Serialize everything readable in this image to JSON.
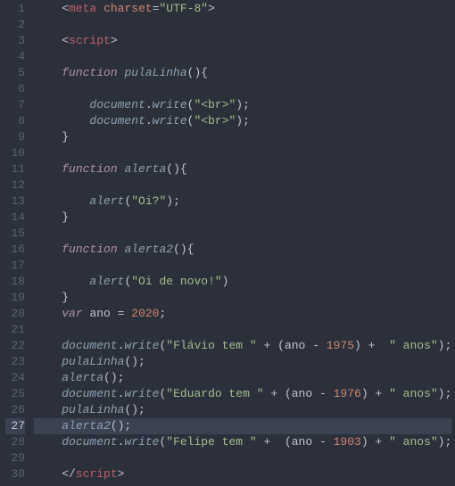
{
  "lines": [
    {
      "n": 1,
      "hl": false,
      "seg": [
        {
          "c": "txt",
          "t": "    "
        },
        {
          "c": "lt",
          "t": "<"
        },
        {
          "c": "tag",
          "t": "meta"
        },
        {
          "c": "txt",
          "t": " "
        },
        {
          "c": "attr",
          "t": "charset"
        },
        {
          "c": "pun",
          "t": "="
        },
        {
          "c": "str",
          "t": "\"UTF-8\""
        },
        {
          "c": "lt",
          "t": ">"
        }
      ]
    },
    {
      "n": 2,
      "hl": false,
      "seg": [
        {
          "c": "txt",
          "t": ""
        }
      ]
    },
    {
      "n": 3,
      "hl": false,
      "seg": [
        {
          "c": "txt",
          "t": "    "
        },
        {
          "c": "lt",
          "t": "<"
        },
        {
          "c": "tag",
          "t": "script"
        },
        {
          "c": "lt",
          "t": ">"
        }
      ]
    },
    {
      "n": 4,
      "hl": false,
      "seg": [
        {
          "c": "txt",
          "t": ""
        }
      ]
    },
    {
      "n": 5,
      "hl": false,
      "seg": [
        {
          "c": "txt",
          "t": "    "
        },
        {
          "c": "kw",
          "t": "function"
        },
        {
          "c": "txt",
          "t": " "
        },
        {
          "c": "fn",
          "t": "pulaLinha"
        },
        {
          "c": "pun",
          "t": "(){"
        }
      ]
    },
    {
      "n": 6,
      "hl": false,
      "seg": [
        {
          "c": "txt",
          "t": ""
        }
      ]
    },
    {
      "n": 7,
      "hl": false,
      "seg": [
        {
          "c": "txt",
          "t": "        "
        },
        {
          "c": "obj",
          "t": "document"
        },
        {
          "c": "pun",
          "t": "."
        },
        {
          "c": "fn",
          "t": "write"
        },
        {
          "c": "pun",
          "t": "("
        },
        {
          "c": "str",
          "t": "\"<br>\""
        },
        {
          "c": "pun",
          "t": ");"
        }
      ]
    },
    {
      "n": 8,
      "hl": false,
      "seg": [
        {
          "c": "txt",
          "t": "        "
        },
        {
          "c": "obj",
          "t": "document"
        },
        {
          "c": "pun",
          "t": "."
        },
        {
          "c": "fn",
          "t": "write"
        },
        {
          "c": "pun",
          "t": "("
        },
        {
          "c": "str",
          "t": "\"<br>\""
        },
        {
          "c": "pun",
          "t": ");"
        }
      ]
    },
    {
      "n": 9,
      "hl": false,
      "seg": [
        {
          "c": "txt",
          "t": "    "
        },
        {
          "c": "pun",
          "t": "}"
        }
      ]
    },
    {
      "n": 10,
      "hl": false,
      "seg": [
        {
          "c": "txt",
          "t": ""
        }
      ]
    },
    {
      "n": 11,
      "hl": false,
      "seg": [
        {
          "c": "txt",
          "t": "    "
        },
        {
          "c": "kw",
          "t": "function"
        },
        {
          "c": "txt",
          "t": " "
        },
        {
          "c": "fn",
          "t": "alerta"
        },
        {
          "c": "pun",
          "t": "(){"
        }
      ]
    },
    {
      "n": 12,
      "hl": false,
      "seg": [
        {
          "c": "txt",
          "t": ""
        }
      ]
    },
    {
      "n": 13,
      "hl": false,
      "seg": [
        {
          "c": "txt",
          "t": "        "
        },
        {
          "c": "fn",
          "t": "alert"
        },
        {
          "c": "pun",
          "t": "("
        },
        {
          "c": "str",
          "t": "\"Oi?\""
        },
        {
          "c": "pun",
          "t": ");"
        }
      ]
    },
    {
      "n": 14,
      "hl": false,
      "seg": [
        {
          "c": "txt",
          "t": "    "
        },
        {
          "c": "pun",
          "t": "}"
        }
      ]
    },
    {
      "n": 15,
      "hl": false,
      "seg": [
        {
          "c": "txt",
          "t": ""
        }
      ]
    },
    {
      "n": 16,
      "hl": false,
      "seg": [
        {
          "c": "txt",
          "t": "    "
        },
        {
          "c": "kw",
          "t": "function"
        },
        {
          "c": "txt",
          "t": " "
        },
        {
          "c": "fn",
          "t": "alerta2"
        },
        {
          "c": "pun",
          "t": "(){"
        }
      ]
    },
    {
      "n": 17,
      "hl": false,
      "seg": [
        {
          "c": "txt",
          "t": ""
        }
      ]
    },
    {
      "n": 18,
      "hl": false,
      "seg": [
        {
          "c": "txt",
          "t": "        "
        },
        {
          "c": "fn",
          "t": "alert"
        },
        {
          "c": "pun",
          "t": "("
        },
        {
          "c": "str",
          "t": "\"Oi de novo!\""
        },
        {
          "c": "pun",
          "t": ")"
        }
      ]
    },
    {
      "n": 19,
      "hl": false,
      "seg": [
        {
          "c": "txt",
          "t": "    "
        },
        {
          "c": "pun",
          "t": "}"
        }
      ]
    },
    {
      "n": 20,
      "hl": false,
      "seg": [
        {
          "c": "txt",
          "t": "    "
        },
        {
          "c": "kw2",
          "t": "var"
        },
        {
          "c": "txt",
          "t": " "
        },
        {
          "c": "txt",
          "t": "ano "
        },
        {
          "c": "op",
          "t": "="
        },
        {
          "c": "txt",
          "t": " "
        },
        {
          "c": "num",
          "t": "2020"
        },
        {
          "c": "pun",
          "t": ";"
        }
      ]
    },
    {
      "n": 21,
      "hl": false,
      "seg": [
        {
          "c": "txt",
          "t": ""
        }
      ]
    },
    {
      "n": 22,
      "hl": false,
      "seg": [
        {
          "c": "txt",
          "t": "    "
        },
        {
          "c": "obj",
          "t": "document"
        },
        {
          "c": "pun",
          "t": "."
        },
        {
          "c": "fn",
          "t": "write"
        },
        {
          "c": "pun",
          "t": "("
        },
        {
          "c": "str",
          "t": "\"Flávio tem \""
        },
        {
          "c": "txt",
          "t": " "
        },
        {
          "c": "op",
          "t": "+"
        },
        {
          "c": "txt",
          "t": " "
        },
        {
          "c": "pun",
          "t": "("
        },
        {
          "c": "txt",
          "t": "ano "
        },
        {
          "c": "op",
          "t": "-"
        },
        {
          "c": "txt",
          "t": " "
        },
        {
          "c": "num",
          "t": "1975"
        },
        {
          "c": "pun",
          "t": ")"
        },
        {
          "c": "txt",
          "t": " "
        },
        {
          "c": "op",
          "t": "+"
        },
        {
          "c": "txt",
          "t": "  "
        },
        {
          "c": "str",
          "t": "\" anos\""
        },
        {
          "c": "pun",
          "t": ");"
        }
      ]
    },
    {
      "n": 23,
      "hl": false,
      "seg": [
        {
          "c": "txt",
          "t": "    "
        },
        {
          "c": "fn",
          "t": "pulaLinha"
        },
        {
          "c": "pun",
          "t": "();"
        }
      ]
    },
    {
      "n": 24,
      "hl": false,
      "seg": [
        {
          "c": "txt",
          "t": "    "
        },
        {
          "c": "fn",
          "t": "alerta"
        },
        {
          "c": "pun",
          "t": "();"
        }
      ]
    },
    {
      "n": 25,
      "hl": false,
      "seg": [
        {
          "c": "txt",
          "t": "    "
        },
        {
          "c": "obj",
          "t": "document"
        },
        {
          "c": "pun",
          "t": "."
        },
        {
          "c": "fn",
          "t": "write"
        },
        {
          "c": "pun",
          "t": "("
        },
        {
          "c": "str",
          "t": "\"Eduardo tem \""
        },
        {
          "c": "txt",
          "t": " "
        },
        {
          "c": "op",
          "t": "+"
        },
        {
          "c": "txt",
          "t": " "
        },
        {
          "c": "pun",
          "t": "("
        },
        {
          "c": "txt",
          "t": "ano "
        },
        {
          "c": "op",
          "t": "-"
        },
        {
          "c": "txt",
          "t": " "
        },
        {
          "c": "num",
          "t": "1976"
        },
        {
          "c": "pun",
          "t": ")"
        },
        {
          "c": "txt",
          "t": " "
        },
        {
          "c": "op",
          "t": "+"
        },
        {
          "c": "txt",
          "t": " "
        },
        {
          "c": "str",
          "t": "\" anos\""
        },
        {
          "c": "pun",
          "t": ");"
        }
      ]
    },
    {
      "n": 26,
      "hl": false,
      "seg": [
        {
          "c": "txt",
          "t": "    "
        },
        {
          "c": "fn",
          "t": "pulaLinha"
        },
        {
          "c": "pun",
          "t": "();"
        }
      ]
    },
    {
      "n": 27,
      "hl": true,
      "seg": [
        {
          "c": "txt",
          "t": "    "
        },
        {
          "c": "fn",
          "t": "alerta2"
        },
        {
          "c": "pun",
          "t": "();"
        }
      ]
    },
    {
      "n": 28,
      "hl": false,
      "seg": [
        {
          "c": "txt",
          "t": "    "
        },
        {
          "c": "obj",
          "t": "document"
        },
        {
          "c": "pun",
          "t": "."
        },
        {
          "c": "fn",
          "t": "write"
        },
        {
          "c": "pun",
          "t": "("
        },
        {
          "c": "str",
          "t": "\"Felipe tem \""
        },
        {
          "c": "txt",
          "t": " "
        },
        {
          "c": "op",
          "t": "+"
        },
        {
          "c": "txt",
          "t": "  "
        },
        {
          "c": "pun",
          "t": "("
        },
        {
          "c": "txt",
          "t": "ano "
        },
        {
          "c": "op",
          "t": "-"
        },
        {
          "c": "txt",
          "t": " "
        },
        {
          "c": "num",
          "t": "1903"
        },
        {
          "c": "pun",
          "t": ")"
        },
        {
          "c": "txt",
          "t": " "
        },
        {
          "c": "op",
          "t": "+"
        },
        {
          "c": "txt",
          "t": " "
        },
        {
          "c": "str",
          "t": "\" anos\""
        },
        {
          "c": "pun",
          "t": ");"
        }
      ]
    },
    {
      "n": 29,
      "hl": false,
      "seg": [
        {
          "c": "txt",
          "t": ""
        }
      ]
    },
    {
      "n": 30,
      "hl": false,
      "seg": [
        {
          "c": "txt",
          "t": "    "
        },
        {
          "c": "lt",
          "t": "</"
        },
        {
          "c": "tag",
          "t": "script"
        },
        {
          "c": "lt",
          "t": ">"
        }
      ]
    }
  ]
}
